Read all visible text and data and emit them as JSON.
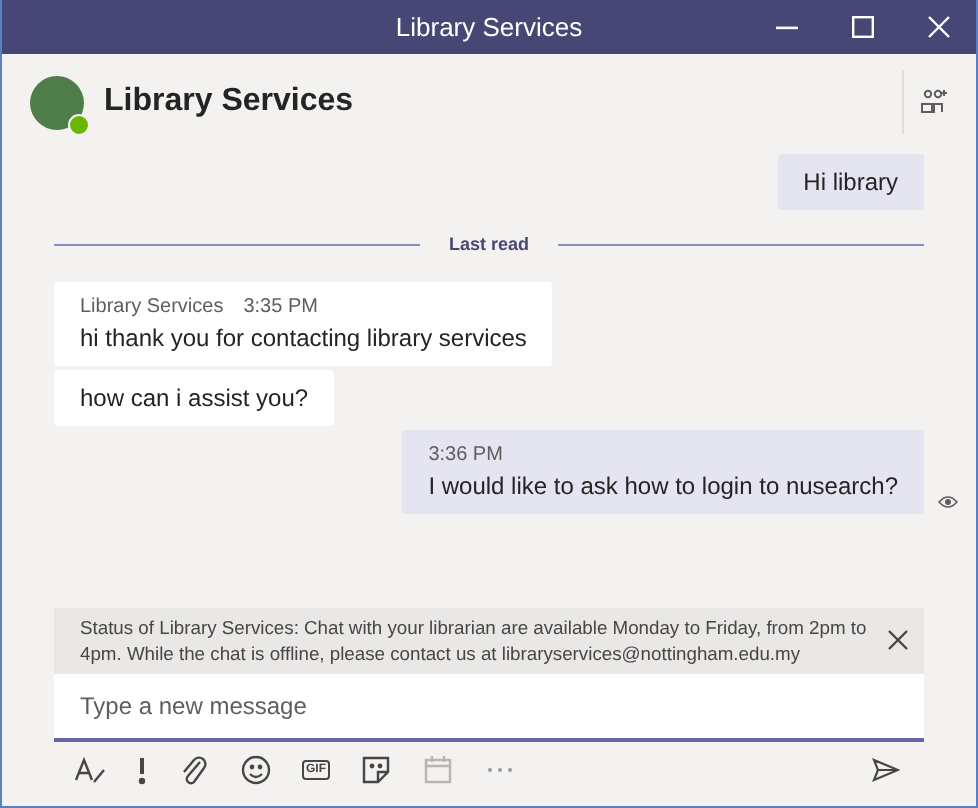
{
  "window": {
    "title": "Library Services"
  },
  "header": {
    "name": "Library Services",
    "status_online": true
  },
  "messages": [
    {
      "kind": "outgoing",
      "text": "Hi library"
    },
    {
      "kind": "divider",
      "text": "Last read"
    },
    {
      "kind": "incoming",
      "sender": "Library Services",
      "time": "3:35 PM",
      "text": "hi thank you for contacting library services"
    },
    {
      "kind": "incoming",
      "text": "how can i assist you?"
    },
    {
      "kind": "outgoing",
      "time": "3:36 PM",
      "text": "I would like to ask how to login to nusearch?",
      "seen": true
    }
  ],
  "status_banner": {
    "text": "Status of Library Services: Chat with your librarian are available Monday to Friday, from 2pm to 4pm. While the chat is offline, please contact us at libraryservices@nottingham.edu.my"
  },
  "compose": {
    "placeholder": "Type a new message"
  },
  "toolbar": [
    {
      "kind": "format"
    },
    {
      "kind": "important"
    },
    {
      "kind": "attach"
    },
    {
      "kind": "emoji"
    },
    {
      "kind": "gif",
      "label": "GIF"
    },
    {
      "kind": "sticker"
    },
    {
      "kind": "meeting",
      "disabled": true
    },
    {
      "kind": "more"
    }
  ]
}
